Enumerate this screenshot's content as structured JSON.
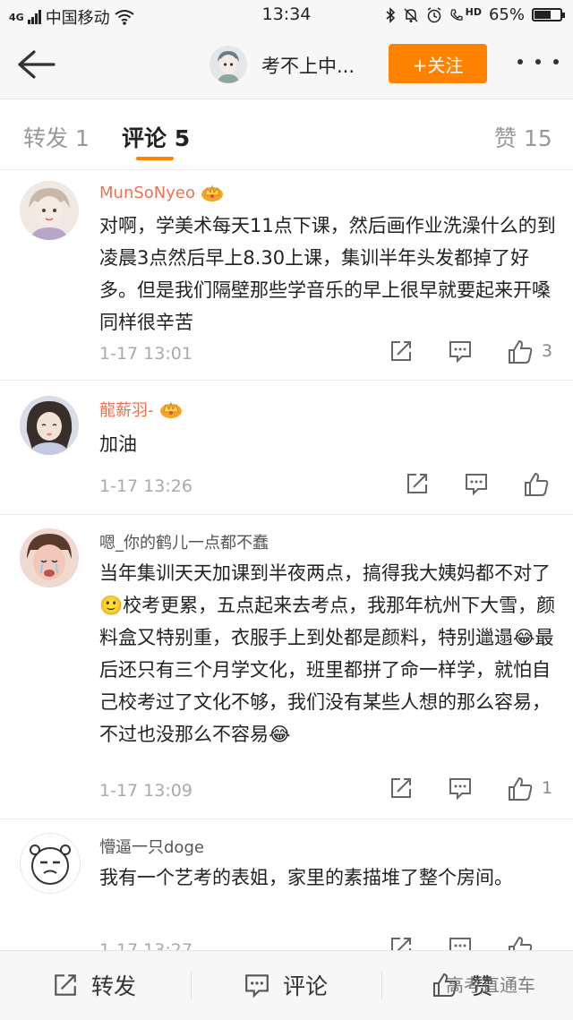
{
  "status_bar": {
    "signal": "4G",
    "carrier": "中国移动",
    "time": "13:34",
    "hd": "HD",
    "battery": "65%",
    "battery_level": 0.65
  },
  "navbar": {
    "title": "考不上中...",
    "follow_label": "+关注"
  },
  "tabs": [
    {
      "label": "转发 1"
    },
    {
      "label": "评论 5"
    },
    {
      "label": "赞 15"
    }
  ],
  "comments": [
    {
      "user": "MunSoNyeo",
      "text": "对啊，学美术每天11点下课，然后画作业洗澡什么的到凌晨3点然后早上8.30上课，集训半年头发都掉了好多。但是我们隔壁那些学音乐的早上很早就要起来开嗓同样很辛苦",
      "time": "1-17 13:01",
      "likes": "3"
    },
    {
      "user": "龍薪羽-",
      "text": "加油",
      "time": "1-17 13:26",
      "likes": ""
    },
    {
      "user": "嗯_你的鹤儿一点都不蠢",
      "text": "当年集训天天加课到半夜两点，搞得我大姨妈都不对了🙂校考更累，五点起来去考点，我那年杭州下大雪，颜料盒又特别重，衣服手上到处都是颜料，特别邋遢😂最后还只有三个月学文化，班里都拼了命一样学，就怕自己校考过了文化不够，我们没有某些人想的那么容易，不过也没那么不容易😂",
      "time": "1-17 13:09",
      "likes": "1"
    },
    {
      "user": "懵逼一只doge",
      "text": "我有一个艺考的表姐，家里的素描堆了整个房间。",
      "time": "1-17 13:27",
      "likes": ""
    }
  ],
  "bottom_bar": {
    "repost_label": "转发",
    "comment_label": "评论",
    "like_label": "赞"
  },
  "watermark": "高考直通车",
  "colors": {
    "accent": "#ff8200",
    "vip_name": "#eb7350"
  }
}
